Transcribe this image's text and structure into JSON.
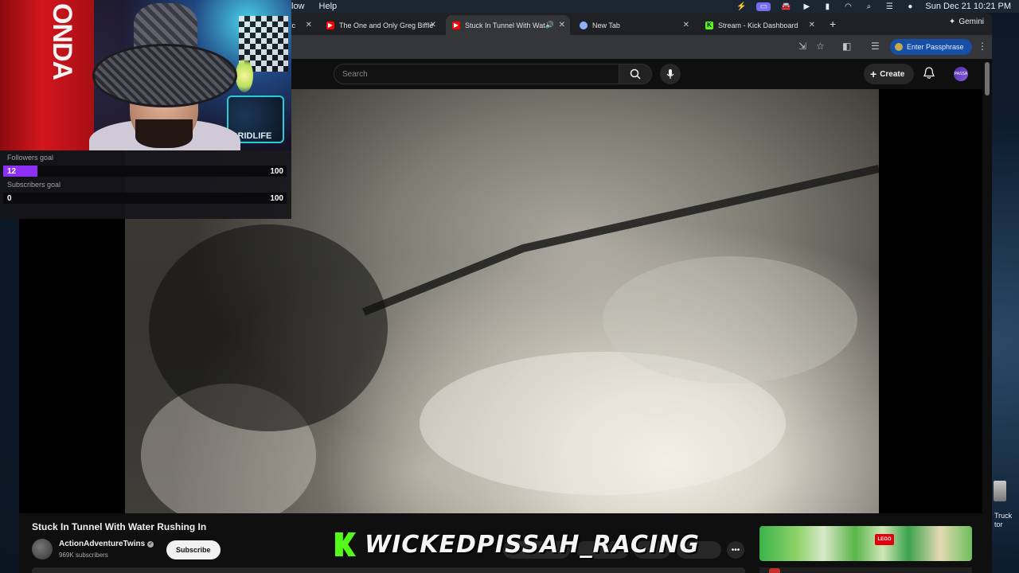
{
  "menubar": {
    "menus": [
      "low",
      "Help"
    ],
    "date_time": "Sun Dec 21  10:21 PM"
  },
  "browser": {
    "tabs": [
      {
        "title": "cc",
        "favicon": "generic"
      },
      {
        "title": "The One and Only Greg Biffle",
        "favicon": "youtube-icon"
      },
      {
        "title": "Stuck In Tunnel With Wat",
        "favicon": "youtube-icon",
        "active": true
      },
      {
        "title": "New Tab",
        "favicon": "chrome-icon"
      },
      {
        "title": "Stream - Kick Dashboard",
        "favicon": "kick-icon"
      }
    ],
    "gemini_label": "Gemini",
    "passphrase_label": "Enter Passphrase"
  },
  "youtube": {
    "search_placeholder": "Search",
    "create_label": "Create",
    "avatar_text": "PASSA",
    "video_title": "Stuck In Tunnel With Water Rushing In",
    "channel_name": "ActionAdventureTwins",
    "subscriber_count": "969K subscribers",
    "subscribe_label": "Subscribe"
  },
  "desktop": {
    "icon_label": "Truck\ntor"
  },
  "stream_overlay": {
    "webcam_text": "ONDA",
    "webcam_poster_text": "GRIDLIFE",
    "followers_goal": {
      "label": "Followers goal",
      "current": "12",
      "target": "100",
      "progress": 0.12
    },
    "subscribers_goal": {
      "label": "Subscribers goal",
      "current": "0",
      "target": "100",
      "progress": 0.0
    },
    "channel_banner": "WICKEDPISSAH_RACING"
  },
  "colors": {
    "kick_green": "#53fc18",
    "goal_fill": "#8e2ff5",
    "youtube_red": "#ff0000",
    "passphrase_blue": "#174ea6"
  }
}
